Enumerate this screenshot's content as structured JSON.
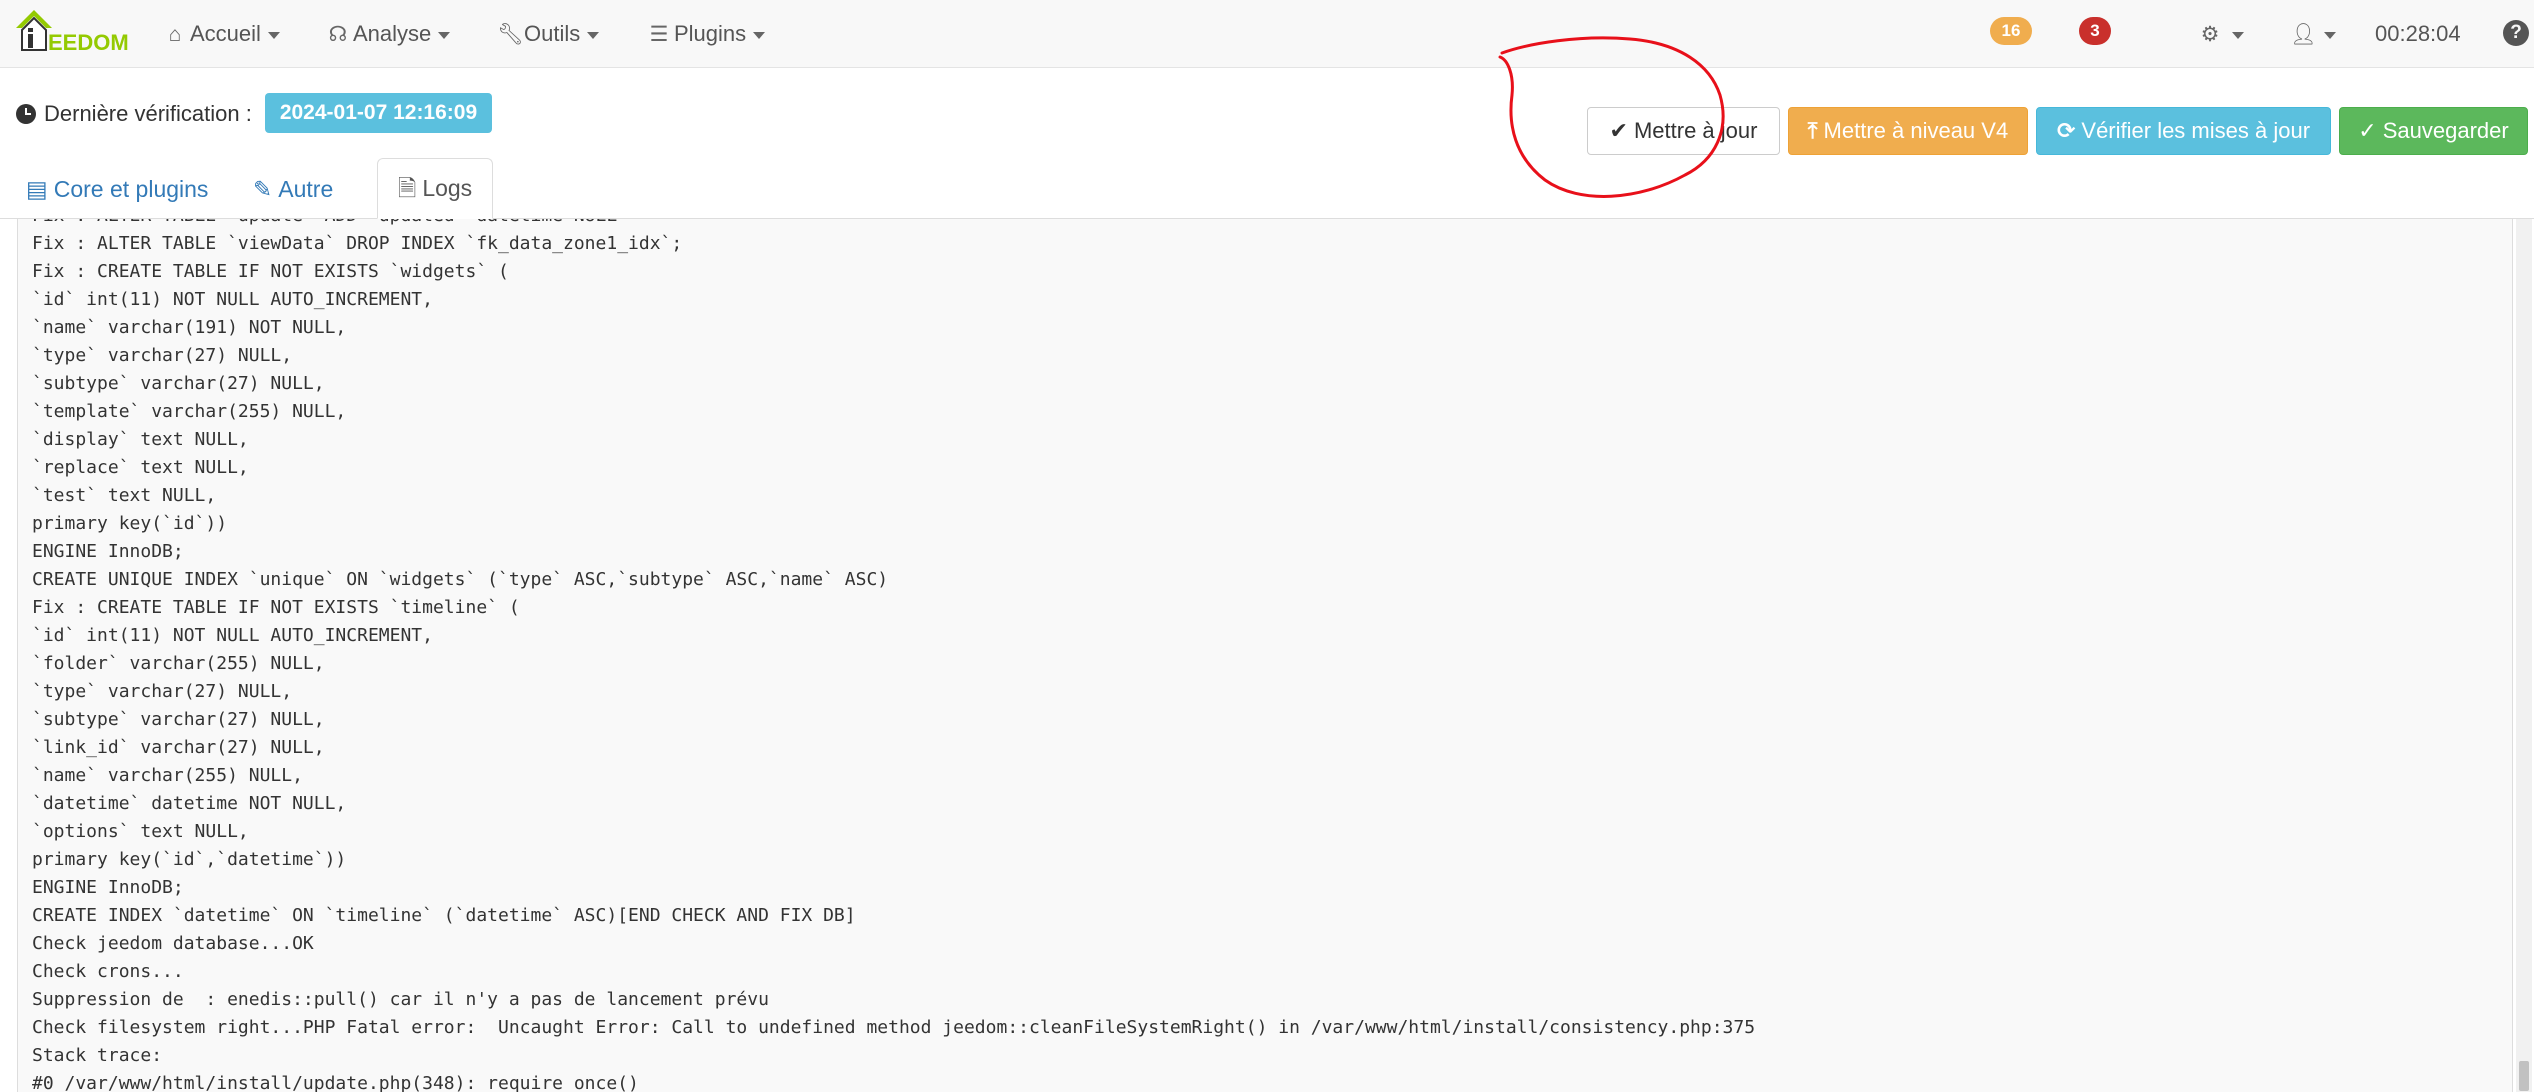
{
  "brand": {
    "name": "EEDOM",
    "green": "#94ca02"
  },
  "nav": {
    "items": [
      {
        "label": "Accueil",
        "icon": "home-icon"
      },
      {
        "label": "Analyse",
        "icon": "stethoscope-icon"
      },
      {
        "label": "Outils",
        "icon": "wrench-icon"
      },
      {
        "label": "Plugins",
        "icon": "list-icon"
      }
    ],
    "badge_warning": "16",
    "badge_danger": "3",
    "time": "00:28:04",
    "help": "?"
  },
  "status": {
    "last_check_label": "Dernière vérification :",
    "last_check_date": "2024-01-07 12:16:09"
  },
  "actions": {
    "update": "Mettre à jour",
    "upgrade": "Mettre à niveau V4",
    "check": "Vérifier les mises à jour",
    "save": "Sauvegarder"
  },
  "tabs": [
    {
      "label": "Core et plugins",
      "active": false
    },
    {
      "label": "Autre",
      "active": false
    },
    {
      "label": "Logs",
      "active": true
    }
  ],
  "colors": {
    "info": "#5bc0de",
    "warning": "#f0ad4e",
    "danger": "#c9302c",
    "success": "#5cb85c",
    "link": "#337ab7",
    "annotation": "#e8101a"
  },
  "log_lines": [
    "Fix : ALTER TABLE `update` ADD `updated` datetime NULL",
    "Fix : ALTER TABLE `viewData` DROP INDEX `fk_data_zone1_idx`;",
    "Fix : CREATE TABLE IF NOT EXISTS `widgets` (",
    "`id` int(11) NOT NULL AUTO_INCREMENT,",
    "`name` varchar(191) NOT NULL,",
    "`type` varchar(27) NULL,",
    "`subtype` varchar(27) NULL,",
    "`template` varchar(255) NULL,",
    "`display` text NULL,",
    "`replace` text NULL,",
    "`test` text NULL,",
    "primary key(`id`))",
    "ENGINE InnoDB;",
    "CREATE UNIQUE INDEX `unique` ON `widgets` (`type` ASC,`subtype` ASC,`name` ASC)",
    "Fix : CREATE TABLE IF NOT EXISTS `timeline` (",
    "`id` int(11) NOT NULL AUTO_INCREMENT,",
    "`folder` varchar(255) NULL,",
    "`type` varchar(27) NULL,",
    "`subtype` varchar(27) NULL,",
    "`link_id` varchar(27) NULL,",
    "`name` varchar(255) NULL,",
    "`datetime` datetime NOT NULL,",
    "`options` text NULL,",
    "primary key(`id`,`datetime`))",
    "ENGINE InnoDB;",
    "CREATE INDEX `datetime` ON `timeline` (`datetime` ASC)[END CHECK AND FIX DB]",
    "Check jeedom database...OK",
    "Check crons...",
    "Suppression de  : enedis::pull() car il n'y a pas de lancement prévu",
    "Check filesystem right...PHP Fatal error:  Uncaught Error: Call to undefined method jeedom::cleanFileSystemRight() in /var/www/html/install/consistency.php:375",
    "Stack trace:",
    "#0 /var/www/html/install/update.php(348): require_once()"
  ]
}
